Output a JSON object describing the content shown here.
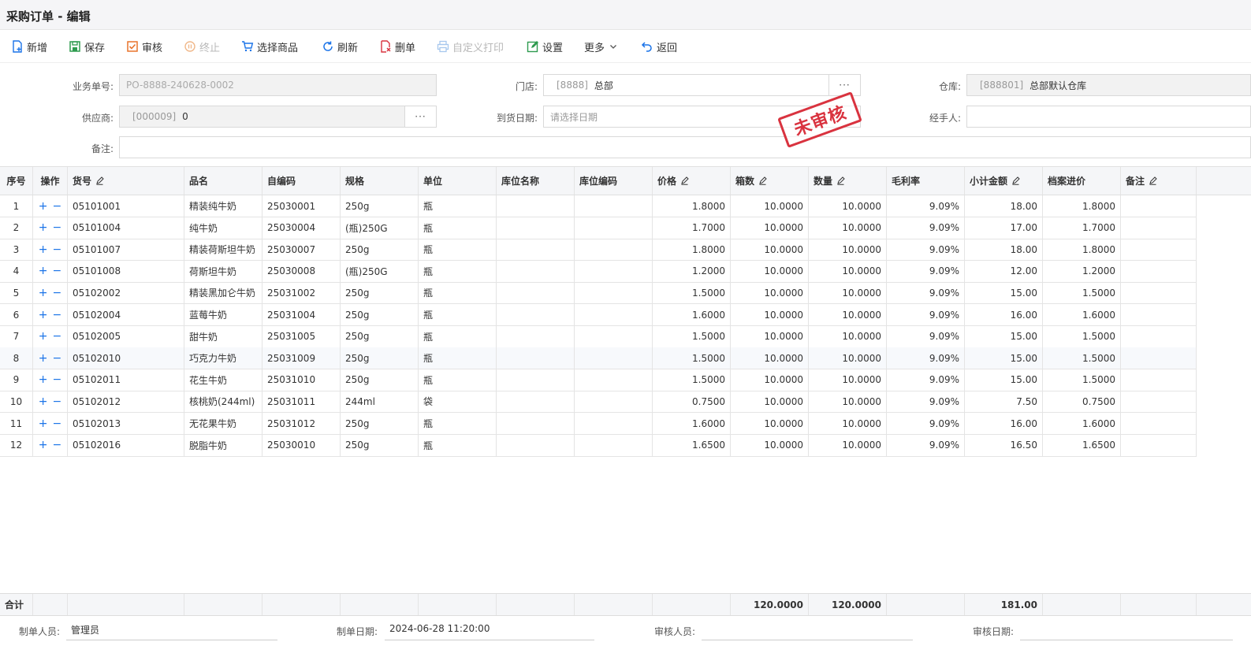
{
  "window": {
    "title": "采购订单 - 编辑"
  },
  "toolbar": {
    "add": "新增",
    "save": "保存",
    "audit": "审核",
    "stop": "终止",
    "select_goods": "选择商品",
    "refresh": "刷新",
    "delete": "删单",
    "custom_print": "自定义打印",
    "settings": "设置",
    "more": "更多",
    "back": "返回"
  },
  "form": {
    "order_no_label": "业务单号:",
    "order_no": "PO-8888-240628-0002",
    "store_label": "门店:",
    "store_code": "[8888]",
    "store_name": "总部",
    "warehouse_label": "仓库:",
    "warehouse_code": "[888801]",
    "warehouse_name": "总部默认仓库",
    "supplier_label": "供应商:",
    "supplier_code": "[000009]",
    "supplier_name": "0",
    "arrival_label": "到货日期:",
    "arrival_placeholder": "请选择日期",
    "handler_label": "经手人:",
    "remark_label": "备注:",
    "dots": "···"
  },
  "stamp": "未审核",
  "table": {
    "headers": [
      "序号",
      "操作",
      "货号",
      "品名",
      "自编码",
      "规格",
      "单位",
      "库位名称",
      "库位编码",
      "价格",
      "箱数",
      "数量",
      "毛利率",
      "小计金额",
      "档案进价",
      "备注"
    ],
    "rows": [
      [
        "1",
        "05101001",
        "精装纯牛奶",
        "25030001",
        "250g",
        "瓶",
        "1.8000",
        "10.0000",
        "10.0000",
        "9.09%",
        "18.00",
        "1.8000"
      ],
      [
        "2",
        "05101004",
        "纯牛奶",
        "25030004",
        "(瓶)250G",
        "瓶",
        "1.7000",
        "10.0000",
        "10.0000",
        "9.09%",
        "17.00",
        "1.7000"
      ],
      [
        "3",
        "05101007",
        "精装荷斯坦牛奶",
        "25030007",
        "250g",
        "瓶",
        "1.8000",
        "10.0000",
        "10.0000",
        "9.09%",
        "18.00",
        "1.8000"
      ],
      [
        "4",
        "05101008",
        "荷斯坦牛奶",
        "25030008",
        "(瓶)250G",
        "瓶",
        "1.2000",
        "10.0000",
        "10.0000",
        "9.09%",
        "12.00",
        "1.2000"
      ],
      [
        "5",
        "05102002",
        "精装黑加仑牛奶",
        "25031002",
        "250g",
        "瓶",
        "1.5000",
        "10.0000",
        "10.0000",
        "9.09%",
        "15.00",
        "1.5000"
      ],
      [
        "6",
        "05102004",
        "蓝莓牛奶",
        "25031004",
        "250g",
        "瓶",
        "1.6000",
        "10.0000",
        "10.0000",
        "9.09%",
        "16.00",
        "1.6000"
      ],
      [
        "7",
        "05102005",
        "甜牛奶",
        "25031005",
        "250g",
        "瓶",
        "1.5000",
        "10.0000",
        "10.0000",
        "9.09%",
        "15.00",
        "1.5000"
      ],
      [
        "8",
        "05102010",
        "巧克力牛奶",
        "25031009",
        "250g",
        "瓶",
        "1.5000",
        "10.0000",
        "10.0000",
        "9.09%",
        "15.00",
        "1.5000"
      ],
      [
        "9",
        "05102011",
        "花生牛奶",
        "25031010",
        "250g",
        "瓶",
        "1.5000",
        "10.0000",
        "10.0000",
        "9.09%",
        "15.00",
        "1.5000"
      ],
      [
        "10",
        "05102012",
        "核桃奶(244ml)",
        "25031011",
        "244ml",
        "袋",
        "0.7500",
        "10.0000",
        "10.0000",
        "9.09%",
        "7.50",
        "0.7500"
      ],
      [
        "11",
        "05102013",
        "无花果牛奶",
        "25031012",
        "250g",
        "瓶",
        "1.6000",
        "10.0000",
        "10.0000",
        "9.09%",
        "16.00",
        "1.6000"
      ],
      [
        "12",
        "05102016",
        "脱脂牛奶",
        "25030010",
        "250g",
        "瓶",
        "1.6500",
        "10.0000",
        "10.0000",
        "9.09%",
        "16.50",
        "1.6500"
      ]
    ],
    "ops_plus": "+",
    "ops_minus": "−",
    "totals_label": "合计",
    "total_boxes": "120.0000",
    "total_qty": "120.0000",
    "total_amount": "181.00"
  },
  "footer": {
    "creator_label": "制单人员:",
    "creator": "管理员",
    "created_label": "制单日期:",
    "created": "2024-06-28 11:20:00",
    "auditor_label": "审核人员:",
    "auditor": "",
    "audited_label": "审核日期:",
    "audited": ""
  },
  "colors": {
    "accent": "#1a73e8",
    "stamp": "#d9333f",
    "header_bg": "#f5f6f8"
  }
}
